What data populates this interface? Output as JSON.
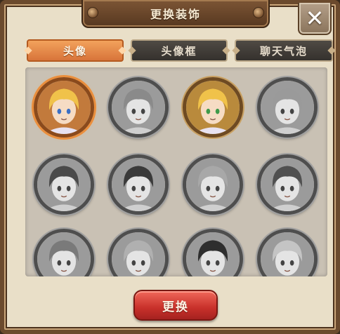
{
  "dialog": {
    "title": "更换装饰",
    "close_symbol": "✕"
  },
  "tabs": [
    {
      "label": "头像",
      "active": true
    },
    {
      "label": "头像框",
      "active": false
    },
    {
      "label": "聊天气泡",
      "active": false
    }
  ],
  "avatars": [
    {
      "character": "blonde-boy-blue-eyes",
      "unlocked": true,
      "selected": true
    },
    {
      "character": "wavy-hair-girl",
      "unlocked": false,
      "selected": false
    },
    {
      "character": "blonde-boy-green-eyes",
      "unlocked": true,
      "selected": false
    },
    {
      "character": "light-hair-girl",
      "unlocked": false,
      "selected": false
    },
    {
      "character": "long-hair-woman",
      "unlocked": false,
      "selected": false
    },
    {
      "character": "hooded-boy-grin",
      "unlocked": false,
      "selected": false
    },
    {
      "character": "white-hair-boy",
      "unlocked": false,
      "selected": false
    },
    {
      "character": "dark-hair-man",
      "unlocked": false,
      "selected": false
    },
    {
      "character": "bob-hair-girl",
      "unlocked": false,
      "selected": false
    },
    {
      "character": "bandana-boy",
      "unlocked": false,
      "selected": false
    },
    {
      "character": "glasses-girl",
      "unlocked": false,
      "selected": false
    },
    {
      "character": "bonnet-girl",
      "unlocked": false,
      "selected": false
    }
  ],
  "confirm_button": {
    "label": "更换"
  },
  "colors": {
    "active_tab": "#e28a46",
    "confirm_button": "#d0382f",
    "panel_bg": "#c9c1b4"
  }
}
